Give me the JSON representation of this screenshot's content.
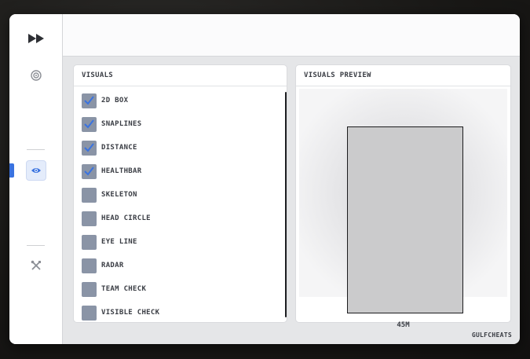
{
  "colors": {
    "accent": "#3a73e0",
    "checkbox": "#8a94a6",
    "panel_bg": "#ffffff",
    "window_bg": "#e5e6e8"
  },
  "sidebar": {
    "items": [
      {
        "icon": "fast-forward-icon",
        "active": false
      },
      {
        "icon": "target-icon",
        "active": false
      },
      {
        "icon": "eye-icon",
        "active": true
      },
      {
        "icon": "wrench-screwdriver-icon",
        "active": false
      }
    ]
  },
  "visuals": {
    "title": "VISUALS",
    "options": [
      {
        "label": "2D BOX",
        "checked": true
      },
      {
        "label": "SNAPLINES",
        "checked": true
      },
      {
        "label": "DISTANCE",
        "checked": true
      },
      {
        "label": "HEALTHBAR",
        "checked": true
      },
      {
        "label": "SKELETON",
        "checked": false
      },
      {
        "label": "HEAD CIRCLE",
        "checked": false
      },
      {
        "label": "EYE LINE",
        "checked": false
      },
      {
        "label": "RADAR",
        "checked": false
      },
      {
        "label": "TEAM CHECK",
        "checked": false
      },
      {
        "label": "VISIBLE CHECK",
        "checked": false
      }
    ]
  },
  "preview": {
    "title": "VISUALS PREVIEW",
    "distance": "45M"
  },
  "footer": {
    "brand": "GULFCHEATS"
  }
}
